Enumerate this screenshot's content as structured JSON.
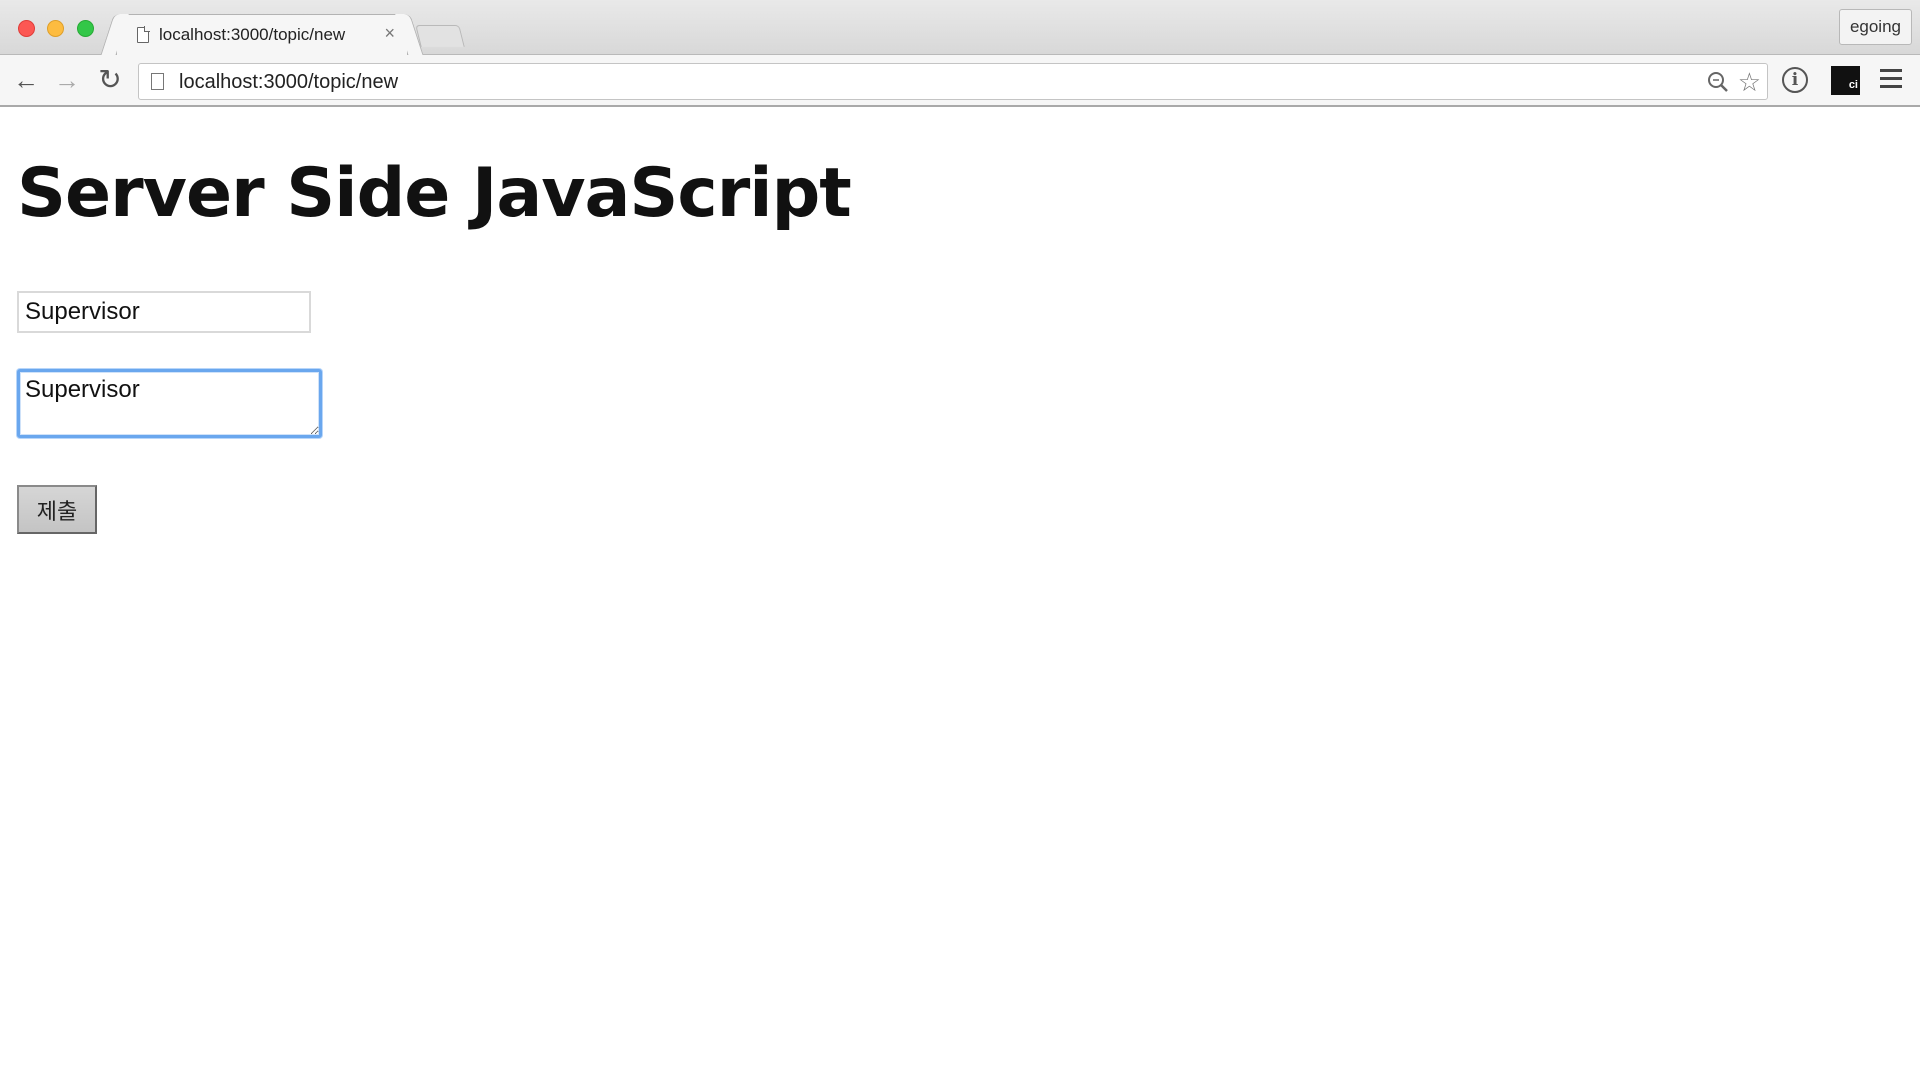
{
  "browser": {
    "tab": {
      "title": "localhost:3000/topic/new",
      "close_glyph": "×"
    },
    "profile_label": "egoing",
    "nav": {
      "back_glyph": "←",
      "forward_glyph": "→",
      "reload_glyph": "↻"
    },
    "omnibox": {
      "url": "localhost:3000/topic/new",
      "star_glyph": "☆"
    },
    "extensions": {
      "info_glyph": "i",
      "ci_label": "ci"
    }
  },
  "page": {
    "title": "Server Side JavaScript",
    "form": {
      "title_value": "Supervisor",
      "description_value": "Supervisor ",
      "submit_label": "제출"
    }
  },
  "colors": {
    "focus_ring": "#6aa7ee",
    "close": "#fc5753",
    "minimize": "#fdbc40",
    "maximize": "#33c748"
  },
  "icons": [
    "page-icon",
    "back-arrow-icon",
    "forward-arrow-icon",
    "reload-icon",
    "zoom-icon",
    "star-icon",
    "info-icon",
    "ci-extension-icon",
    "menu-icon"
  ]
}
